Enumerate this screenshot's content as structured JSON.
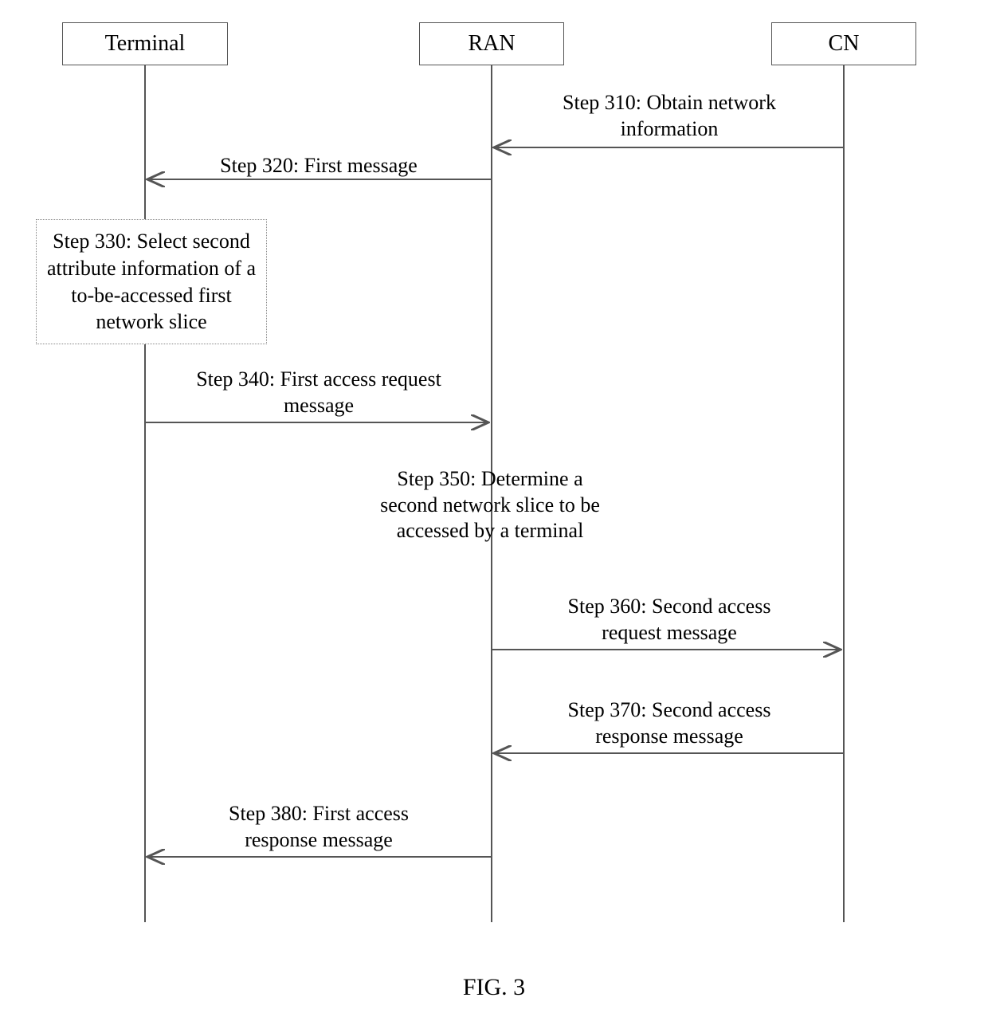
{
  "actors": {
    "terminal": "Terminal",
    "ran": "RAN",
    "cn": "CN"
  },
  "messages": {
    "step310": "Step 310: Obtain network\ninformation",
    "step320": "Step 320: First message",
    "step330": "Step 330: Select second\nattribute information of a\nto-be-accessed first\nnetwork slice",
    "step340": "Step 340: First access request\nmessage",
    "step350": "Step 350: Determine a\nsecond network slice to be\naccessed by a terminal",
    "step360": "Step 360: Second access\nrequest message",
    "step370": "Step 370: Second access\nresponse message",
    "step380": "Step 380: First access\nresponse message"
  },
  "caption": "FIG. 3"
}
